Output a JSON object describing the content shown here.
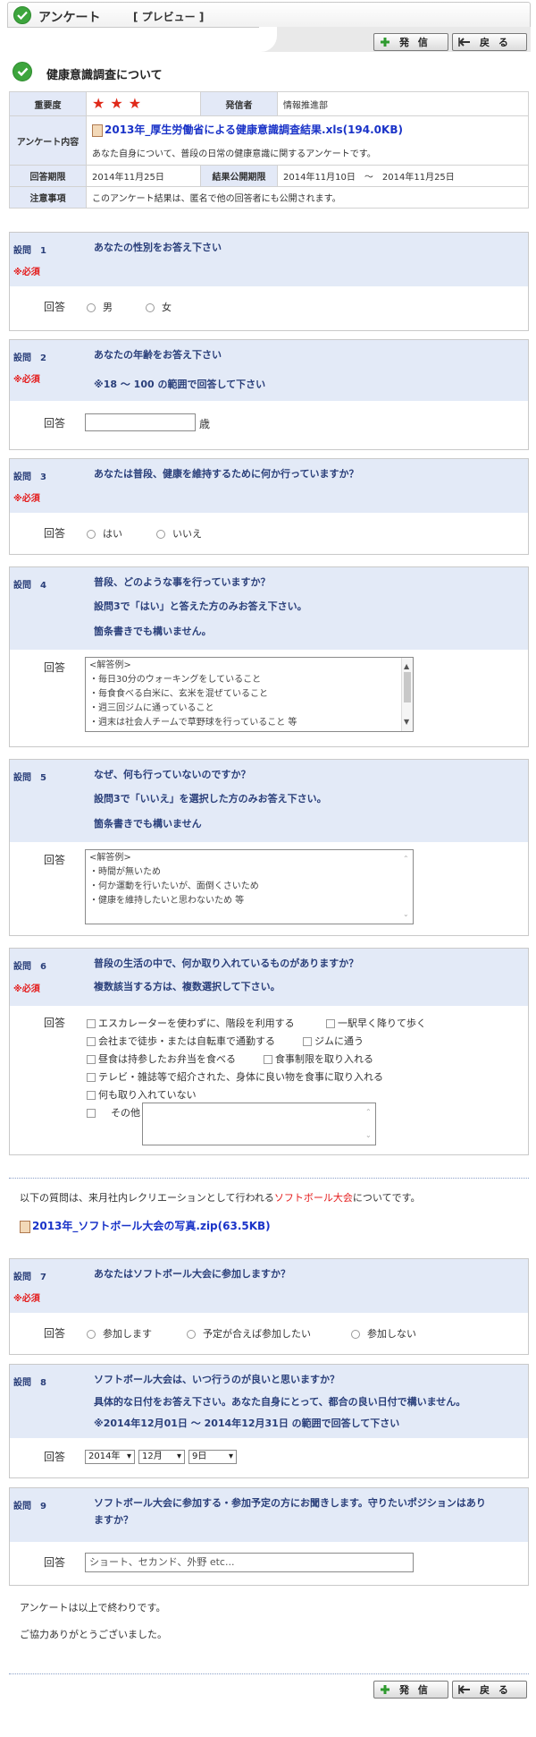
{
  "header": {
    "title": "アンケート",
    "subtitle": "[ プレビュー ]",
    "send_label": "発 信",
    "back_label": "戻 る"
  },
  "survey_title": "健康意識調査について",
  "info": {
    "importance_label": "重要度",
    "importance_stars": 3,
    "publisher_label": "発信者",
    "publisher": "情報推進部",
    "content_label": "アンケート内容",
    "attachment": "2013年_厚生労働省による健康意識調査結果.xls(194.0KB)",
    "description": "あなた自身について、普段の日常の健康意識に関するアンケートです。",
    "deadline_label": "回答期限",
    "deadline": "2014年11月25日",
    "result_label": "結果公開期限",
    "result_period": "2014年11月10日　〜　2014年11月25日",
    "notes_label": "注意事項",
    "notes": "このアンケート結果は、匿名で他の回答者にも公開されます。"
  },
  "answer_label": "回答",
  "required_label": "※必須",
  "q1": {
    "num": "設問　1",
    "text": "あなたの性別をお答え下さい",
    "options": [
      "男",
      "女"
    ]
  },
  "q2": {
    "num": "設問　2",
    "text": "あなたの年齢をお答え下さい",
    "note": "※18 〜 100 の範囲で回答して下さい",
    "unit": "歳"
  },
  "q3": {
    "num": "設問　3",
    "text": "あなたは普段、健康を維持するために何か行っていますか？",
    "options": [
      "はい",
      "いいえ"
    ]
  },
  "q4": {
    "num": "設問　4",
    "lines": [
      "普段、どのような事を行っていますか？",
      "設問3で「はい」と答えた方のみお答え下さい。",
      "箇条書きでも構いません。"
    ],
    "textarea": [
      "<解答例>",
      "・毎日30分のウォーキングをしていること",
      "・毎食食べる白米に、玄米を混ぜていること",
      "・週三回ジムに通っていること",
      "・週末は社会人チームで草野球を行っていること 等"
    ]
  },
  "q5": {
    "num": "設問　5",
    "lines": [
      "なぜ、何も行っていないのですか？",
      "設問3で「いいえ」を選択した方のみお答え下さい。",
      "箇条書きでも構いません"
    ],
    "textarea": [
      "<解答例>",
      "・時間が無いため",
      "・何か運動を行いたいが、面倒くさいため",
      "・健康を維持したいと思わないため 等"
    ]
  },
  "q6": {
    "num": "設問　6",
    "lines": [
      "普段の生活の中で、何か取り入れているものがありますか？",
      "複数該当する方は、複数選択して下さい。"
    ],
    "options": [
      "エスカレーターを使わずに、階段を利用する",
      "一駅早く降りて歩く",
      "会社まで徒歩・または自転車で通勤する",
      "ジムに通う",
      "昼食は持参したお弁当を食べる",
      "食事制限を取り入れる",
      "テレビ・雑誌等で紹介された、身体に良い物を食事に取り入れる",
      "何も取り入れていない",
      "その他"
    ]
  },
  "section": {
    "text_before": "以下の質問は、来月社内レクリエーションとして行われる",
    "highlight": "ソフトボール大会",
    "text_after": "についてです。",
    "attachment": "2013年_ソフトボール大会の写真.zip(63.5KB)",
    "highlight_color": "#e41c1c"
  },
  "q7": {
    "num": "設問　7",
    "text": "あなたはソフトボール大会に参加しますか？",
    "options": [
      "参加します",
      "予定が合えば参加したい",
      "参加しない"
    ]
  },
  "q8": {
    "num": "設問　8",
    "lines": [
      "ソフトボール大会は、いつ行うのが良いと思いますか？",
      "具体的な日付をお答え下さい。あなた自身にとって、都合の良い日付で構いません。",
      "※2014年12月01日 〜 2014年12月31日 の範囲で回答して下さい"
    ],
    "year": "2014年",
    "month": "12月",
    "day": "9日"
  },
  "q9": {
    "num": "設問　9",
    "lines": [
      "ソフトボール大会に参加する・参加予定の方にお聞きします。守りたいポジションはあり",
      "ますか？"
    ],
    "placeholder": "ショート、セカンド、外野 etc..."
  },
  "footer": {
    "end_text": "アンケートは以上で終わりです。",
    "thanks": "ご協力ありがとうございました。"
  },
  "colors": {
    "accent": "#2a3f7a",
    "required": "#e41c1c",
    "question_bg": "#e3eaf7",
    "link": "#1a33c8"
  }
}
